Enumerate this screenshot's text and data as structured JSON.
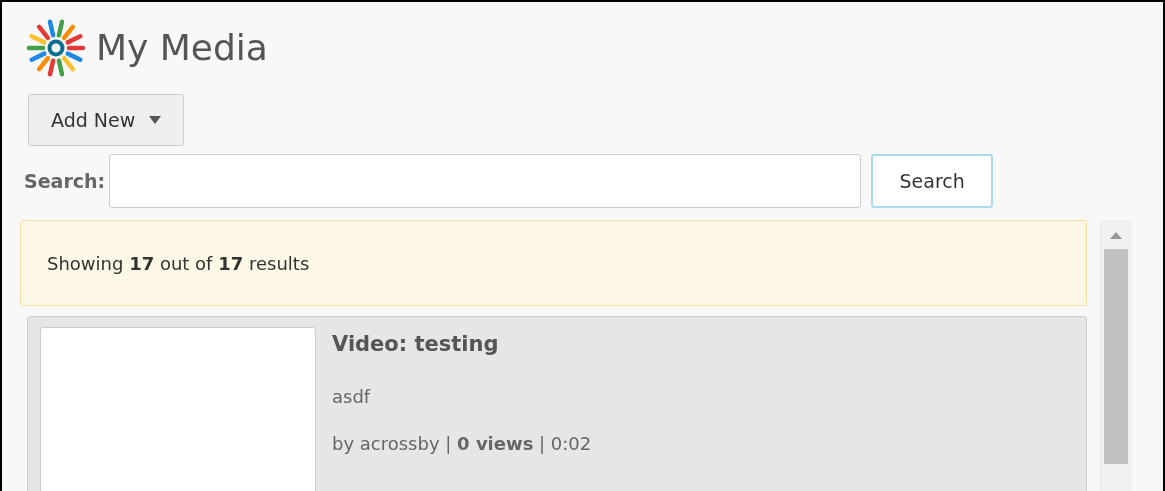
{
  "header": {
    "title": "My Media"
  },
  "add_button": {
    "label": "Add New"
  },
  "search": {
    "label": "Search:",
    "button": "Search"
  },
  "notice": "Showing **17** out of **17** results",
  "media": [
    {
      "title": "Video: testing",
      "description": "asdf",
      "meta": "by acrossby | **0 views** | 0:02"
    }
  ]
}
